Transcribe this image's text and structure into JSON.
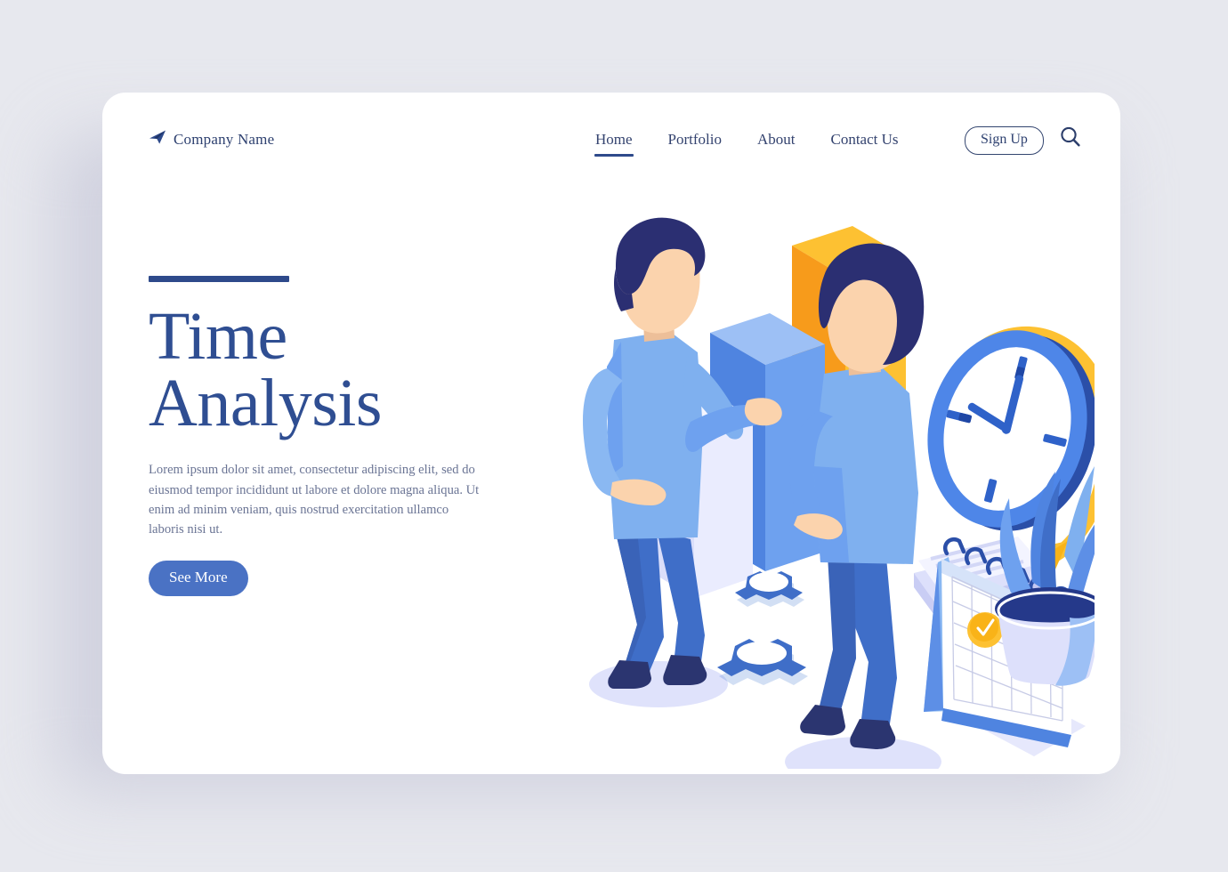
{
  "page": {
    "background_color": "#e7e8ee",
    "card_color": "#ffffff"
  },
  "colors": {
    "navy": "#2e4170",
    "heading_blue": "#2f4e92",
    "accent_blue": "#4a72c4",
    "body_text": "#6a7494",
    "rule": "#2e4a8b",
    "illustration_blue": "#6b9ae8",
    "illustration_dark_blue": "#3f6ec8",
    "illustration_orange": "#f79b1b",
    "illustration_yellow": "#fdc132",
    "illustration_lavender": "#e3e5fa",
    "hair_navy": "#2b2f72",
    "skin": "#fbd3ad"
  },
  "header": {
    "brand": {
      "icon": "paper-plane-icon",
      "name": "Company Name"
    },
    "nav": [
      {
        "label": "Home",
        "active": true
      },
      {
        "label": "Portfolio",
        "active": false
      },
      {
        "label": "About",
        "active": false
      },
      {
        "label": "Contact Us",
        "active": false
      }
    ],
    "signup_label": "Sign Up",
    "search_icon": "search-icon"
  },
  "hero": {
    "rule": true,
    "heading_line1": "Time",
    "heading_line2": "Analysis",
    "body": "Lorem ipsum dolor sit amet, consectetur adipiscing elit, sed do eiusmod tempor incididunt ut labore et dolore magna aliqua. Ut enim ad minim veniam, quis nostrud exercitation ullamco laboris nisi ut.",
    "cta_label": "See More"
  },
  "illustration": {
    "name": "time-analysis-isometric-illustration",
    "elements": [
      "person-left-standing",
      "person-right-back-facing",
      "bar-chart-lavender",
      "bar-chart-blue",
      "bar-chart-orange",
      "clock-with-yellow-arrow",
      "document-stack",
      "desk-calendar-with-check",
      "gear-small",
      "gear-large",
      "potted-plant"
    ]
  }
}
